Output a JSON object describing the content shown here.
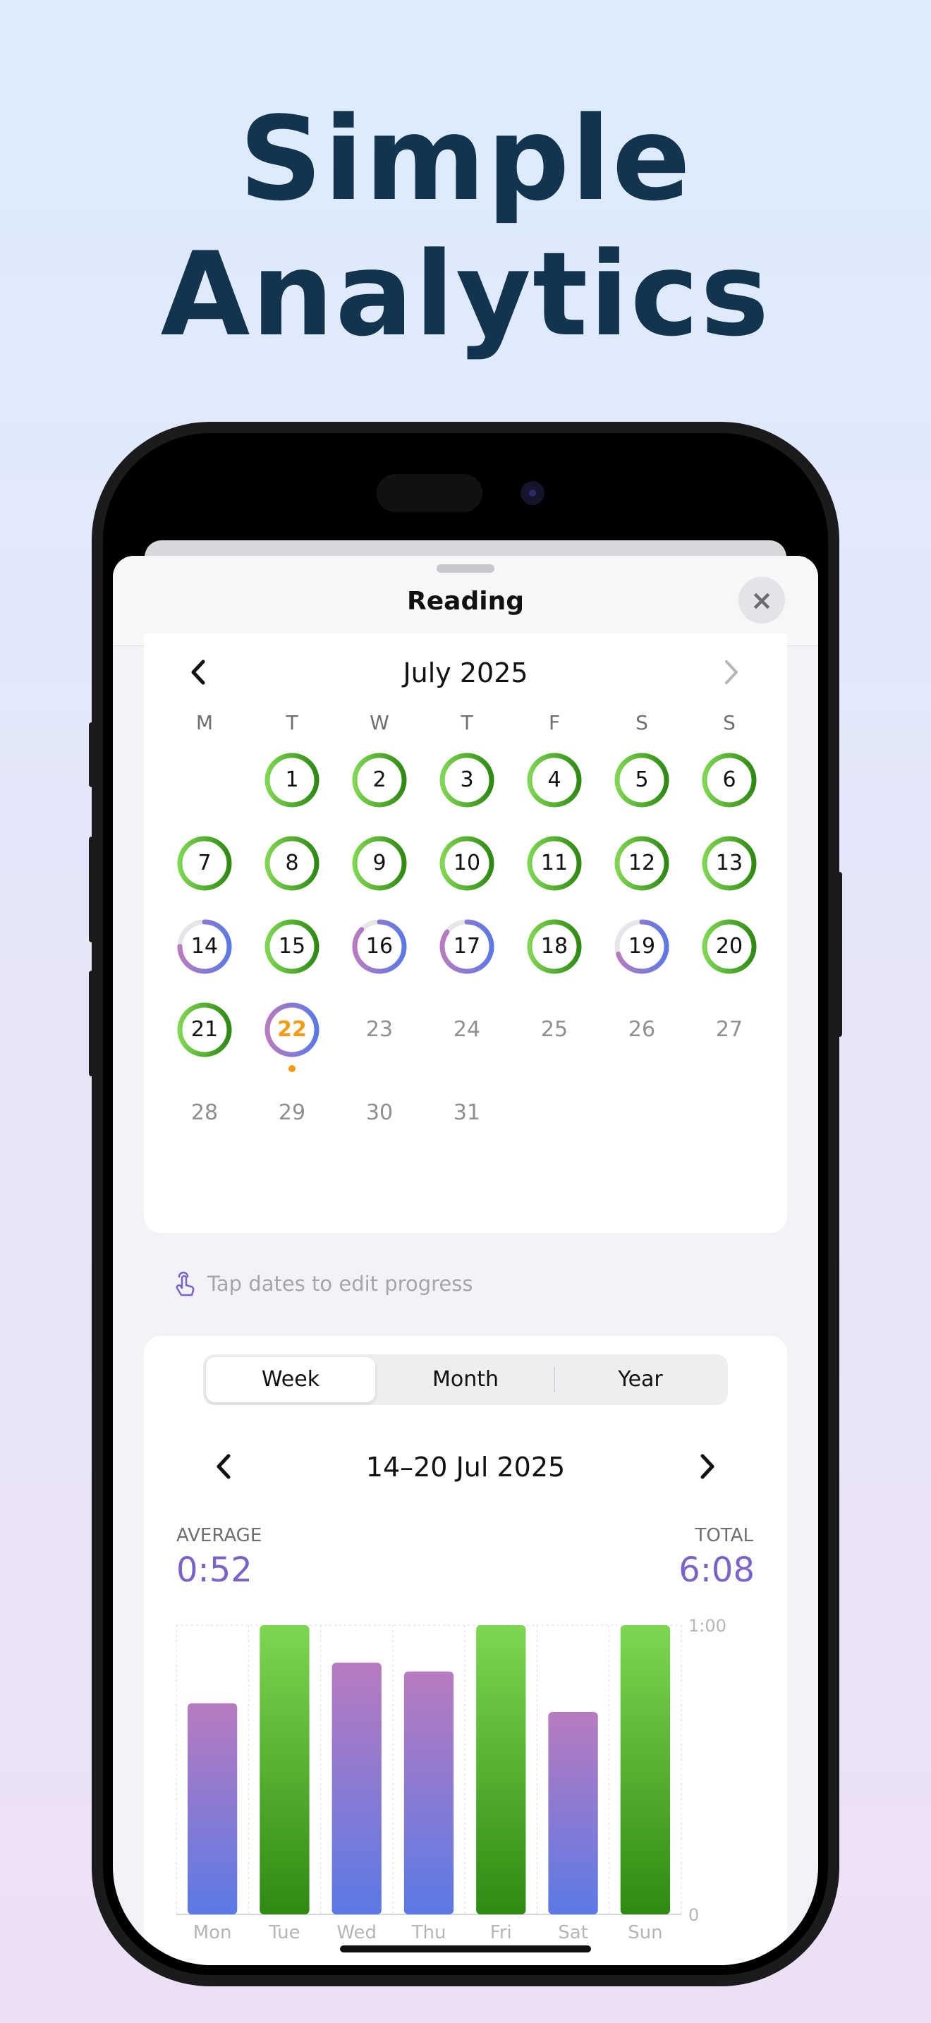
{
  "headline": {
    "line1": "Simple",
    "line2": "Analytics"
  },
  "sheet": {
    "title": "Reading",
    "close_icon": "×"
  },
  "calendar": {
    "month_title": "July 2025",
    "prev_icon": "‹",
    "next_icon": "›",
    "weekdays": [
      "M",
      "T",
      "W",
      "T",
      "F",
      "S",
      "S"
    ],
    "leading_blanks": 1,
    "days": [
      {
        "n": "1",
        "state": "complete"
      },
      {
        "n": "2",
        "state": "complete"
      },
      {
        "n": "3",
        "state": "complete"
      },
      {
        "n": "4",
        "state": "complete"
      },
      {
        "n": "5",
        "state": "complete"
      },
      {
        "n": "6",
        "state": "complete"
      },
      {
        "n": "7",
        "state": "complete"
      },
      {
        "n": "8",
        "state": "complete"
      },
      {
        "n": "9",
        "state": "complete"
      },
      {
        "n": "10",
        "state": "complete"
      },
      {
        "n": "11",
        "state": "complete"
      },
      {
        "n": "12",
        "state": "complete"
      },
      {
        "n": "13",
        "state": "complete"
      },
      {
        "n": "14",
        "state": "partial",
        "progress": 0.75
      },
      {
        "n": "15",
        "state": "complete"
      },
      {
        "n": "16",
        "state": "partial",
        "progress": 0.87
      },
      {
        "n": "17",
        "state": "partial",
        "progress": 0.85
      },
      {
        "n": "18",
        "state": "complete"
      },
      {
        "n": "19",
        "state": "partial",
        "progress": 0.7
      },
      {
        "n": "20",
        "state": "complete"
      },
      {
        "n": "21",
        "state": "complete"
      },
      {
        "n": "22",
        "state": "today",
        "progress": 1.0
      },
      {
        "n": "23",
        "state": "future"
      },
      {
        "n": "24",
        "state": "future"
      },
      {
        "n": "25",
        "state": "future"
      },
      {
        "n": "26",
        "state": "future"
      },
      {
        "n": "27",
        "state": "future"
      },
      {
        "n": "28",
        "state": "future"
      },
      {
        "n": "29",
        "state": "future"
      },
      {
        "n": "30",
        "state": "future"
      },
      {
        "n": "31",
        "state": "future"
      }
    ]
  },
  "hint": {
    "text": "Tap dates to edit progress",
    "icon": "tap-hand-icon"
  },
  "stats": {
    "segments": [
      "Week",
      "Month",
      "Year"
    ],
    "active_segment": "Week",
    "range_title": "14–20 Jul 2025",
    "average_label": "AVERAGE",
    "average_value": "0:52",
    "total_label": "TOTAL",
    "total_value": "6:08"
  },
  "colors": {
    "complete_top": "#7ed651",
    "complete_bottom": "#2e8a12",
    "partial_top": "#b87bbf",
    "partial_bottom": "#5b79e6",
    "accent": "#7b63c8",
    "today": "#f39c12"
  },
  "chart_data": {
    "type": "bar",
    "categories": [
      "Mon",
      "Tue",
      "Wed",
      "Thu",
      "Fri",
      "Sat",
      "Sun"
    ],
    "values": [
      0.73,
      1.0,
      0.87,
      0.84,
      1.0,
      0.7,
      1.0
    ],
    "goal_met": [
      false,
      true,
      false,
      false,
      true,
      false,
      true
    ],
    "ylim": [
      0,
      1
    ],
    "y_ticks": [
      "0",
      "1:00"
    ],
    "grid": true
  }
}
